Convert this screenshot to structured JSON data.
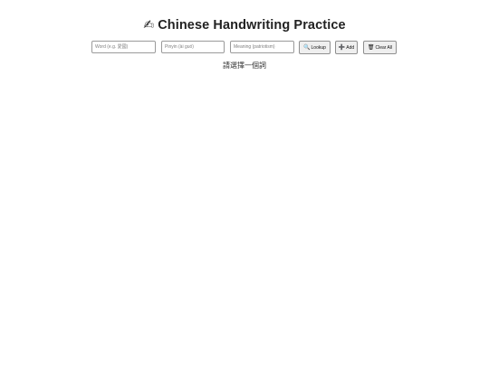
{
  "header": {
    "icon": "writing-hand-icon",
    "icon_glyph": "✍",
    "title": "Chinese Handwriting Practice"
  },
  "toolbar": {
    "word_placeholder": "Word (e.g. 愛國)",
    "pinyin_placeholder": "Pinyin (ài guó)",
    "meaning_placeholder": "Meaning (patriotism)",
    "lookup": {
      "icon": "magnifier-icon",
      "glyph": "🔍",
      "label": "Lookup"
    },
    "add": {
      "icon": "plus-icon",
      "glyph": "➕",
      "label": "Add"
    },
    "clear": {
      "icon": "trash-icon",
      "glyph": "🗑",
      "label": "Clear All"
    }
  },
  "status_text": "請選擇一個詞"
}
